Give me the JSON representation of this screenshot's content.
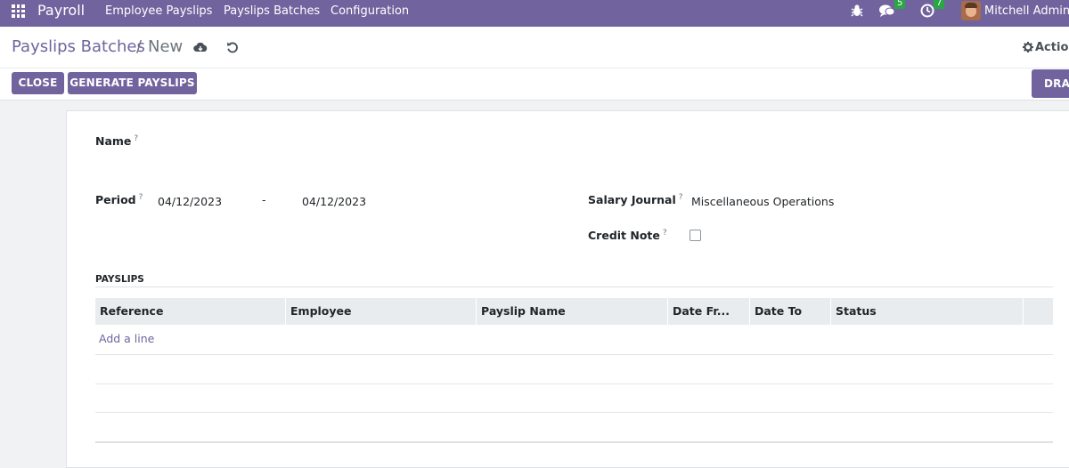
{
  "navbar": {
    "app_name": "Payroll",
    "menus": [
      "Employee Payslips",
      "Payslips Batches",
      "Configuration"
    ],
    "messages_count": "5",
    "activities_count": "7",
    "user_name": "Mitchell Admin (",
    "color": "#71639e"
  },
  "breadcrumb": {
    "parent": "Payslips Batches",
    "separator": "/",
    "current": "New"
  },
  "control_panel": {
    "action_label": "Action",
    "buttons": {
      "close": "CLOSE",
      "generate": "GENERATE PAYSLIPS"
    },
    "status": "DRAFT"
  },
  "form": {
    "name_label": "Name",
    "period_label": "Period",
    "period_from": "04/12/2023",
    "period_sep": "-",
    "period_to": "04/12/2023",
    "journal_label": "Salary Journal",
    "journal_value": "Miscellaneous Operations",
    "credit_note_label": "Credit Note",
    "credit_note_checked": false,
    "help_mark": "?"
  },
  "payslips": {
    "title": "PAYSLIPS",
    "columns": [
      "Reference",
      "Employee",
      "Payslip Name",
      "Date Fr...",
      "Date To",
      "Status"
    ],
    "add_line": "Add a line"
  }
}
